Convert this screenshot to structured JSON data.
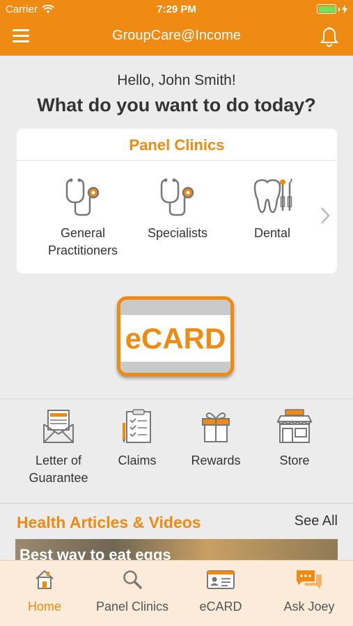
{
  "status_bar": {
    "carrier": "Carrier",
    "time": "7:29 PM",
    "battery_level": 1.0
  },
  "nav": {
    "title": "GroupCare@Income",
    "menu_icon": "hamburger-menu-icon",
    "bell_icon": "bell-icon"
  },
  "greeting": "Hello, John Smith!",
  "question": "What do you want to do today?",
  "panel_clinics": {
    "title": "Panel Clinics",
    "items": [
      {
        "label": "General Practitioners",
        "icon": "stethoscope-icon"
      },
      {
        "label": "Specialists",
        "icon": "stethoscope-icon"
      },
      {
        "label": "Dental",
        "icon": "tooth-icon"
      }
    ]
  },
  "ecard": {
    "label": "eCARD"
  },
  "actions": [
    {
      "label": "Letter of Guarantee",
      "icon": "letter-envelope-icon"
    },
    {
      "label": "Claims",
      "icon": "clipboard-icon"
    },
    {
      "label": "Rewards",
      "icon": "gift-icon"
    },
    {
      "label": "Store",
      "icon": "store-icon"
    }
  ],
  "articles": {
    "title": "Health Articles & Videos",
    "see_all": "See All",
    "first_headline": "Best way to eat eggs"
  },
  "tabs": [
    {
      "label": "Home",
      "icon": "home-icon",
      "active": true
    },
    {
      "label": "Panel Clinics",
      "icon": "search-icon",
      "active": false
    },
    {
      "label": "eCARD",
      "icon": "id-card-icon",
      "active": false
    },
    {
      "label": "Ask Joey",
      "icon": "chat-bubbles-icon",
      "active": false
    }
  ],
  "colors": {
    "accent": "#ef8a12",
    "background": "#ececec",
    "tab_bar": "#fcebd8"
  }
}
